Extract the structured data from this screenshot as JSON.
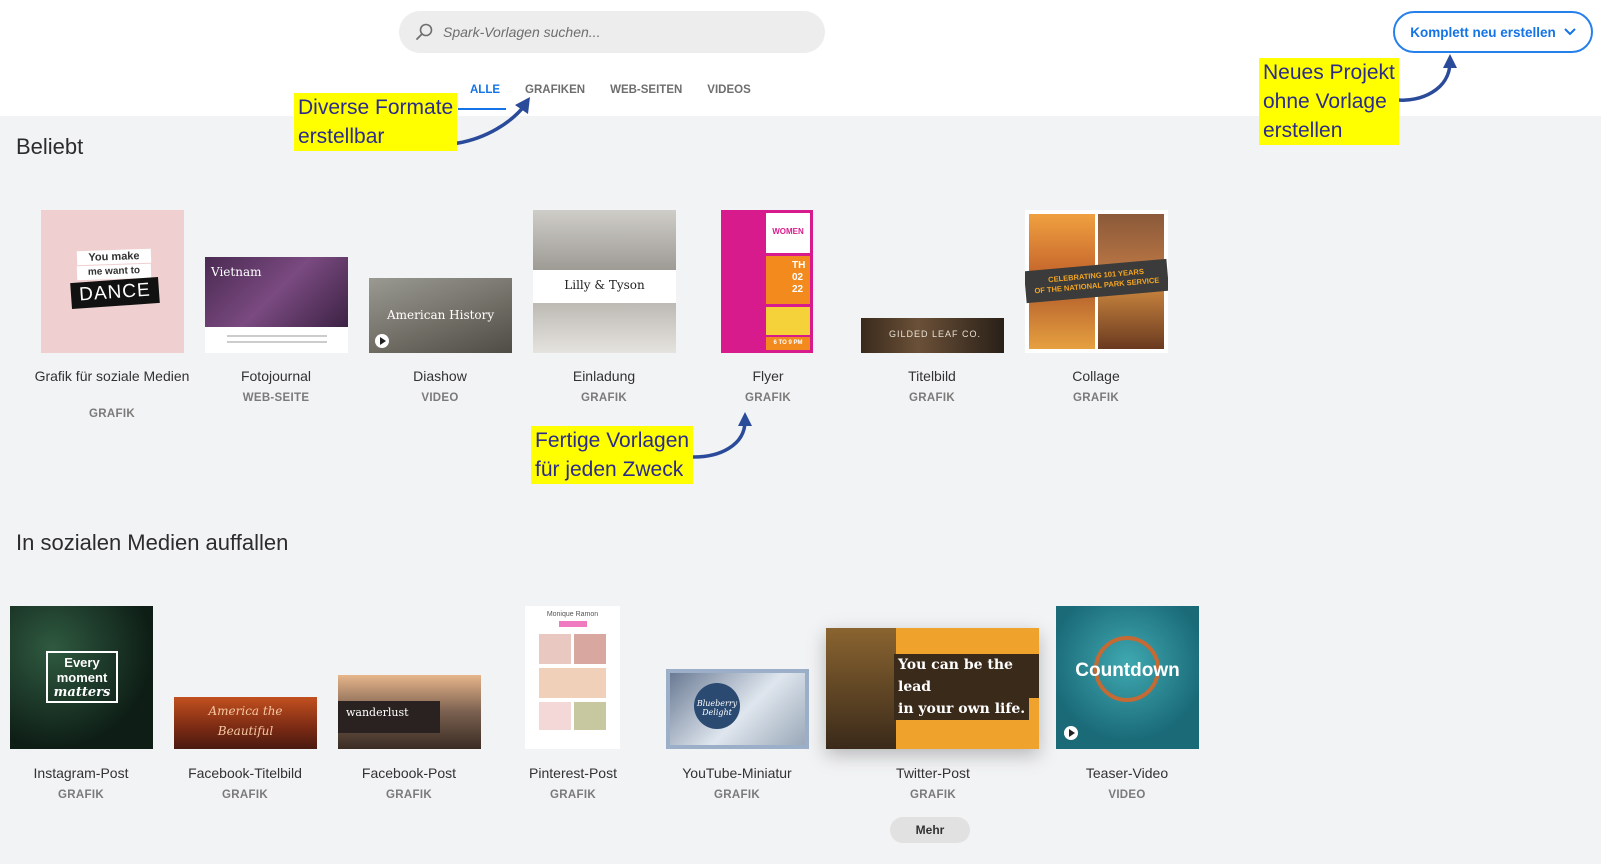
{
  "search": {
    "placeholder": "Spark-Vorlagen suchen..."
  },
  "header": {
    "new_button_label": "Komplett neu erstellen"
  },
  "tabs": [
    {
      "label": "ALLE",
      "active": true
    },
    {
      "label": "GRAFIKEN",
      "active": false
    },
    {
      "label": "WEB-SEITEN",
      "active": false
    },
    {
      "label": "VIDEOS",
      "active": false
    }
  ],
  "sections": {
    "popular": {
      "title": "Beliebt",
      "items": [
        {
          "label": "Grafik für soziale Medien",
          "type": "GRAFIK",
          "thumb_text": [
            "You make",
            "me want to",
            "DANCE"
          ]
        },
        {
          "label": "Fotojournal",
          "type": "WEB-SEITE",
          "thumb_text": [
            "Vietnam"
          ]
        },
        {
          "label": "Diashow",
          "type": "VIDEO",
          "thumb_text": [
            "American History"
          ]
        },
        {
          "label": "Einladung",
          "type": "GRAFIK",
          "thumb_text": [
            "Lilly & Tyson"
          ]
        },
        {
          "label": "Flyer",
          "type": "GRAFIK",
          "thumb_text": [
            "WOMEN",
            "TH",
            "02",
            "22",
            "6 TO 9 PM"
          ]
        },
        {
          "label": "Titelbild",
          "type": "GRAFIK",
          "thumb_text": [
            "GILDED LEAF CO."
          ]
        },
        {
          "label": "Collage",
          "type": "GRAFIK",
          "thumb_text": [
            "CELEBRATING 101 YEARS",
            "OF THE NATIONAL PARK SERVICE"
          ]
        }
      ]
    },
    "social": {
      "title": "In sozialen Medien auffallen",
      "items": [
        {
          "label": "Instagram-Post",
          "type": "GRAFIK",
          "thumb_text": [
            "Every",
            "moment",
            "matters"
          ]
        },
        {
          "label": "Facebook-Titelbild",
          "type": "GRAFIK",
          "thumb_text": [
            "America the",
            "Beautiful"
          ]
        },
        {
          "label": "Facebook-Post",
          "type": "GRAFIK",
          "thumb_text": [
            "wanderlust"
          ]
        },
        {
          "label": "Pinterest-Post",
          "type": "GRAFIK",
          "thumb_text": [
            "Monique Ramon"
          ]
        },
        {
          "label": "YouTube-Miniatur",
          "type": "GRAFIK",
          "thumb_text": [
            "Blueberry Delight"
          ]
        },
        {
          "label": "Twitter-Post",
          "type": "GRAFIK",
          "thumb_text": [
            "You can be the lead",
            "in your own life."
          ]
        },
        {
          "label": "Teaser-Video",
          "type": "VIDEO",
          "thumb_text": [
            "Countdown"
          ]
        }
      ]
    }
  },
  "more_button": "Mehr",
  "annotations": {
    "formats": [
      "Diverse Formate",
      "erstellbar"
    ],
    "new_project": [
      "Neues Projekt",
      "ohne Vorlage",
      "erstellen"
    ],
    "templates": [
      "Fertige Vorlagen",
      "für jeden Zweck"
    ]
  },
  "colors": {
    "accent": "#1473e6",
    "highlight": "#ffff00",
    "annotation_text": "#2b2b8c",
    "arrow": "#2a4a9a"
  }
}
